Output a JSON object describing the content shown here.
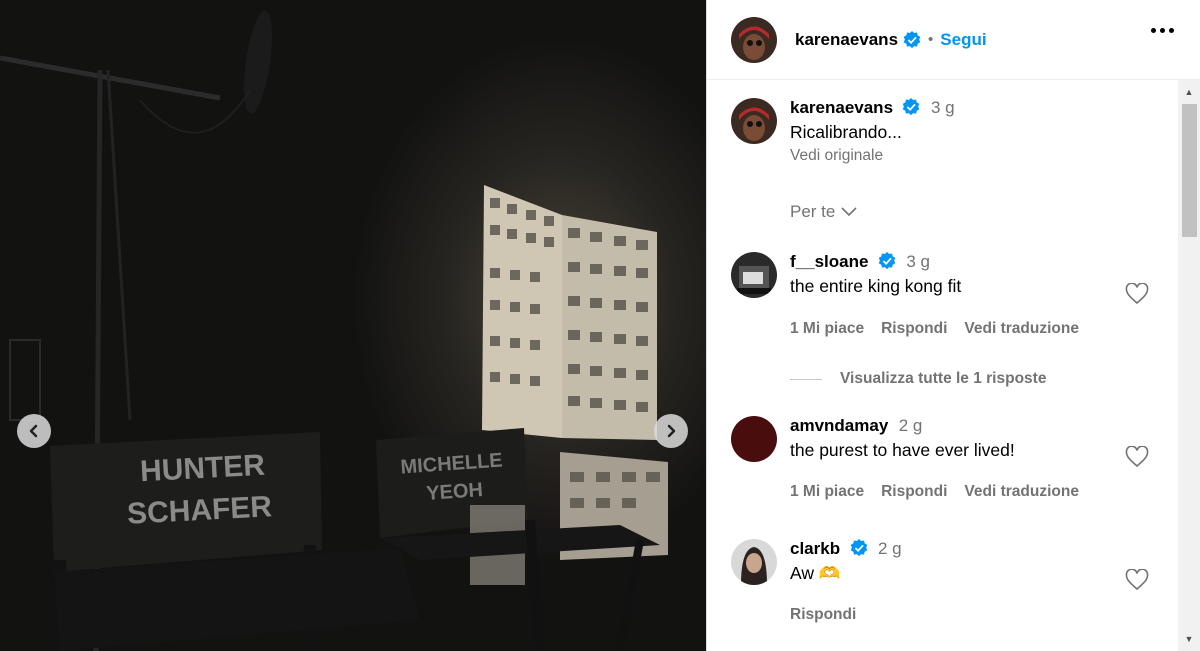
{
  "post": {
    "author": "karenaevans",
    "follow_label": "Segui",
    "separator": "•"
  },
  "caption": {
    "author": "karenaevans",
    "time": "3 g",
    "text": "Ricalibrando...",
    "see_original": "Vedi originale"
  },
  "filter": {
    "label": "Per te"
  },
  "image": {
    "chair_left_text": [
      "HUNTER",
      "SCHAFER"
    ],
    "chair_right_text": [
      "MICHELLE",
      "YEOH"
    ]
  },
  "comments": [
    {
      "author": "f__sloane",
      "verified": true,
      "time": "3 g",
      "text": "the entire king kong fit",
      "likes": "1 Mi piace",
      "reply": "Rispondi",
      "translate": "Vedi traduzione"
    },
    {
      "author": "amvndamay",
      "verified": false,
      "time": "2 g",
      "text": "the purest to have ever lived!",
      "likes": "1 Mi piace",
      "reply": "Rispondi",
      "translate": "Vedi traduzione"
    },
    {
      "author": "clarkb",
      "verified": true,
      "time": "2 g",
      "text": "Aw 🫶",
      "reply": "Rispondi"
    }
  ],
  "view_replies": "Visualizza tutte le 1 risposte",
  "colors": {
    "accent": "#0095f6",
    "verified": "#0095f6",
    "muted": "#737373"
  }
}
